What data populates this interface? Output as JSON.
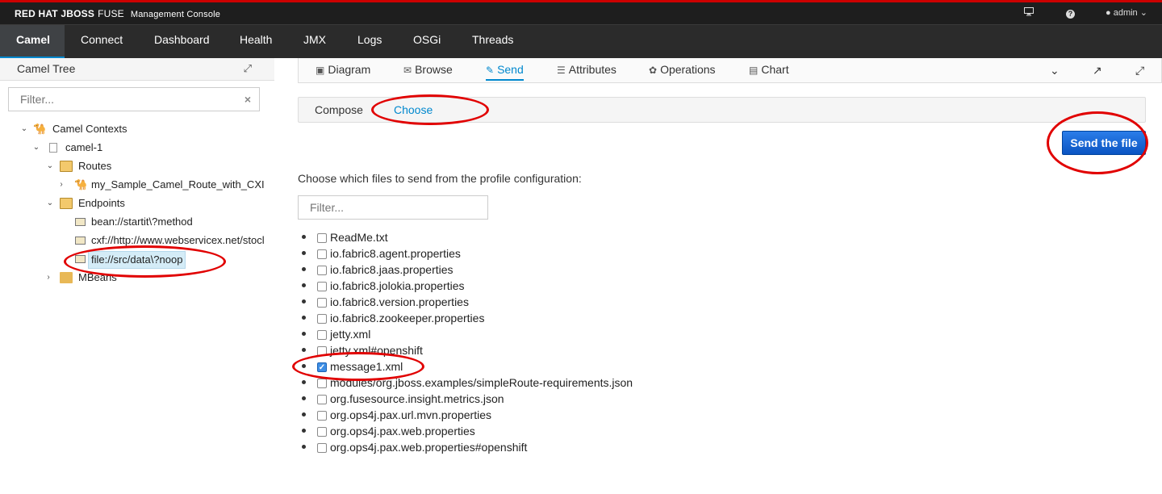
{
  "brand": {
    "name": "RED HAT JBOSS",
    "product": "FUSE",
    "subtitle": "Management Console"
  },
  "utility": {
    "monitor_icon": "monitor-icon",
    "help_icon": "help-icon",
    "user": "admin"
  },
  "nav": {
    "items": [
      {
        "label": "Camel",
        "active": true
      },
      {
        "label": "Connect"
      },
      {
        "label": "Dashboard"
      },
      {
        "label": "Health"
      },
      {
        "label": "JMX"
      },
      {
        "label": "Logs"
      },
      {
        "label": "OSGi"
      },
      {
        "label": "Threads"
      }
    ]
  },
  "sidebar": {
    "title": "Camel Tree",
    "filter_placeholder": "Filter...",
    "tree": {
      "camel_contexts": "Camel Contexts",
      "context": "camel-1",
      "routes": "Routes",
      "route": "my_Sample_Camel_Route_with_CXI",
      "endpoints": "Endpoints",
      "endpoint_items": [
        "bean://startit\\?method",
        "cxf://http://www.webservicex.net/stocl",
        "file://src/data\\?noop"
      ],
      "mbeans": "MBeans"
    }
  },
  "tabs": {
    "items": [
      {
        "label": "Diagram",
        "icon": "image-icon"
      },
      {
        "label": "Browse",
        "icon": "envelope-icon"
      },
      {
        "label": "Send",
        "icon": "pencil-icon",
        "active": true
      },
      {
        "label": "Attributes",
        "icon": "list-icon"
      },
      {
        "label": "Operations",
        "icon": "leaf-icon"
      },
      {
        "label": "Chart",
        "icon": "chart-icon"
      }
    ]
  },
  "subtabs": {
    "compose": "Compose",
    "choose": "Choose",
    "active": "Choose"
  },
  "send_button": "Send the file",
  "instruction": "Choose which files to send from the profile configuration:",
  "file_filter_placeholder": "Filter...",
  "files": [
    {
      "name": "ReadMe.txt",
      "checked": false
    },
    {
      "name": "io.fabric8.agent.properties",
      "checked": false
    },
    {
      "name": "io.fabric8.jaas.properties",
      "checked": false
    },
    {
      "name": "io.fabric8.jolokia.properties",
      "checked": false
    },
    {
      "name": "io.fabric8.version.properties",
      "checked": false
    },
    {
      "name": "io.fabric8.zookeeper.properties",
      "checked": false
    },
    {
      "name": "jetty.xml",
      "checked": false
    },
    {
      "name": "jetty.xml#openshift",
      "checked": false
    },
    {
      "name": "message1.xml",
      "checked": true
    },
    {
      "name": "modules/org.jboss.examples/simpleRoute-requirements.json",
      "checked": false
    },
    {
      "name": "org.fusesource.insight.metrics.json",
      "checked": false
    },
    {
      "name": "org.ops4j.pax.url.mvn.properties",
      "checked": false
    },
    {
      "name": "org.ops4j.pax.web.properties",
      "checked": false
    },
    {
      "name": "org.ops4j.pax.web.properties#openshift",
      "checked": false
    }
  ],
  "colors": {
    "accent": "#0088ce",
    "annotation": "#e10000",
    "brand_red": "#cc0000"
  }
}
